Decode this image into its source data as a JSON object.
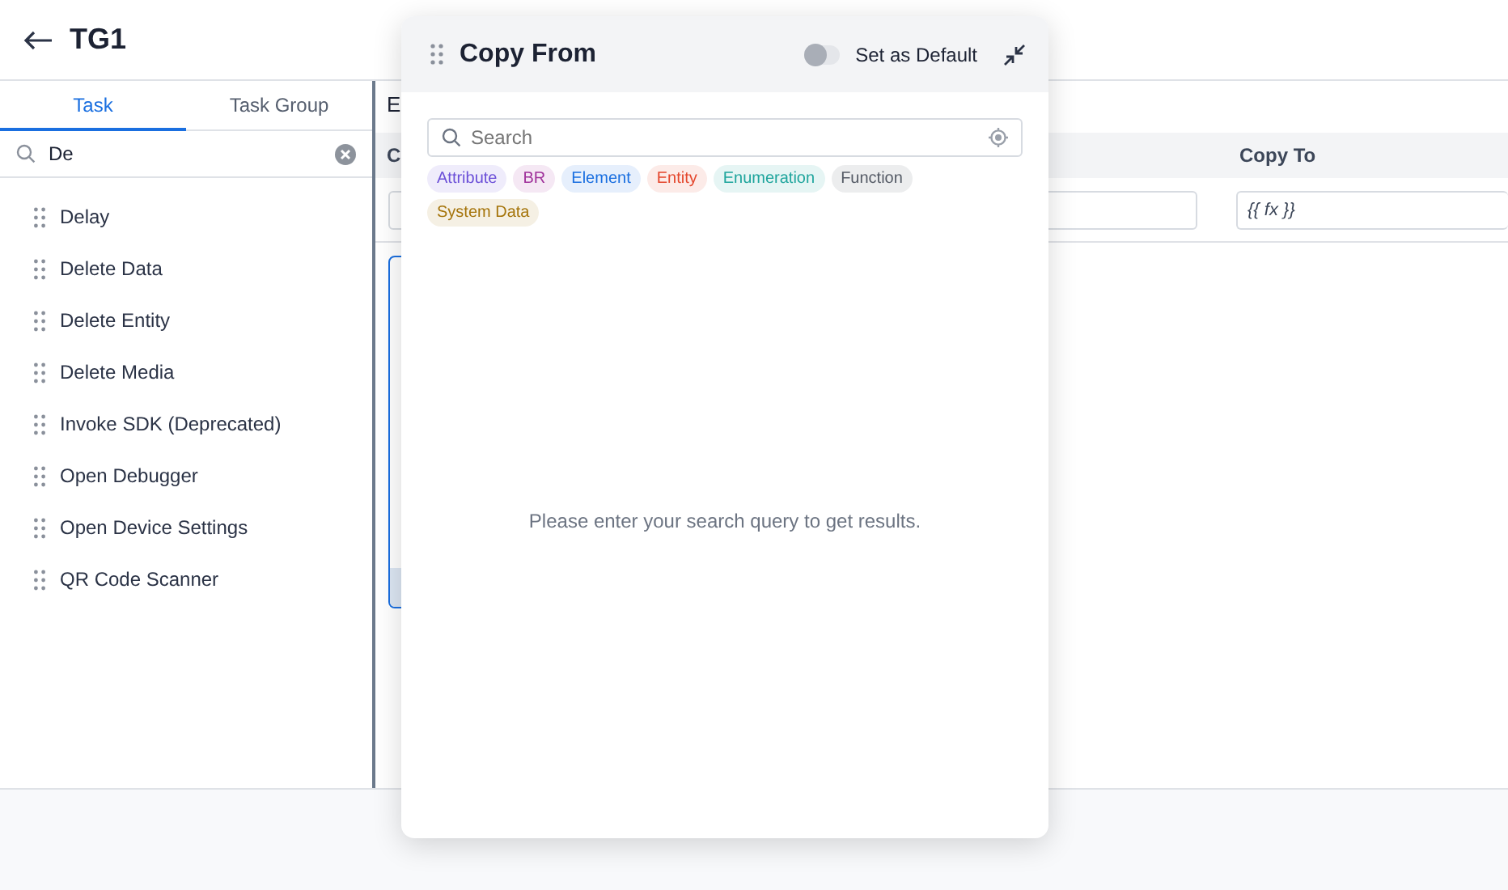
{
  "header": {
    "title": "TG1"
  },
  "tabs": [
    {
      "label": "Task",
      "selected": true
    },
    {
      "label": "Task Group",
      "selected": false
    }
  ],
  "task_search": {
    "value": "De"
  },
  "tasks": [
    "Delay",
    "Delete Data",
    "Delete Entity",
    "Delete Media",
    "Invoke SDK (Deprecated)",
    "Open Debugger",
    "Open Device Settings",
    "QR Code Scanner"
  ],
  "main": {
    "tab_label": "E",
    "columns": [
      "C",
      "Copy To"
    ],
    "copy_to_value": "{{ fx }}"
  },
  "dialog": {
    "title": "Copy From",
    "set_as_default": {
      "label": "Set as Default",
      "on": false
    },
    "search": {
      "placeholder": "Search"
    },
    "filters": [
      {
        "label": "Attribute",
        "color": "#6b4fd8"
      },
      {
        "label": "BR",
        "color": "#a0329b"
      },
      {
        "label": "Element",
        "color": "#1a6fe0"
      },
      {
        "label": "Entity",
        "color": "#e4472d"
      },
      {
        "label": "Enumeration",
        "color": "#1fa59d"
      },
      {
        "label": "Function",
        "color": "#555b66"
      },
      {
        "label": "System Data",
        "color": "#a5740a"
      }
    ],
    "empty_message": "Please enter your search query to get results."
  }
}
